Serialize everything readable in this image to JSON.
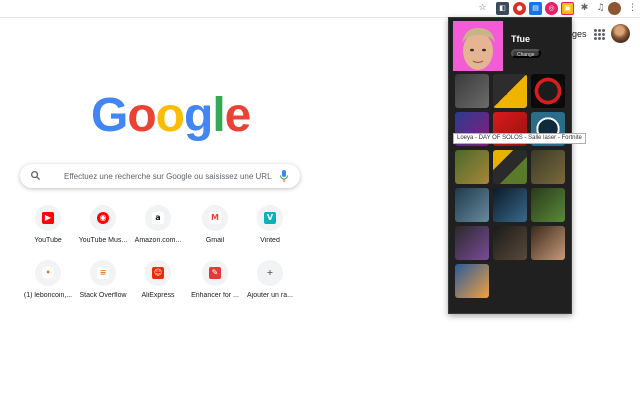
{
  "toolbar": {
    "icons": [
      "star-icon",
      "extension-a-icon",
      "extension-b-icon",
      "extension-c-icon",
      "extension-d-icon",
      "extension-e-icon",
      "extensions-puzzle-icon",
      "media-icon",
      "profile-avatar",
      "menu-dots-icon"
    ]
  },
  "header": {
    "images_link": "ages"
  },
  "logo": {
    "letters": [
      "G",
      "o",
      "o",
      "g",
      "l",
      "e"
    ],
    "colors": [
      "#4285F4",
      "#EA4335",
      "#FBBC05",
      "#4285F4",
      "#34A853",
      "#EA4335"
    ]
  },
  "search": {
    "placeholder": "Effectuez une recherche sur Google ou saisissez une URL"
  },
  "shortcuts": [
    {
      "label": "YouTube",
      "icon": "youtube-icon",
      "color": "#FF0000",
      "glyph": "▶"
    },
    {
      "label": "YouTube Mus...",
      "icon": "youtube-music-icon",
      "color": "#FF0000",
      "glyph": "◉"
    },
    {
      "label": "Amazon.com...",
      "icon": "amazon-icon",
      "color": "#ffffff",
      "glyph": "a"
    },
    {
      "label": "Gmail",
      "icon": "gmail-icon",
      "color": "#ffffff",
      "glyph": "M"
    },
    {
      "label": "Vinted",
      "icon": "vinted-icon",
      "color": "#09B1BA",
      "glyph": "V"
    },
    {
      "label": "(1) leboncoin,...",
      "icon": "leboncoin-icon",
      "color": "#ffffff",
      "glyph": "•"
    },
    {
      "label": "Stack Overflow",
      "icon": "stackoverflow-icon",
      "color": "#ffffff",
      "glyph": "≡"
    },
    {
      "label": "AliExpress",
      "icon": "aliexpress-icon",
      "color": "#E62E04",
      "glyph": "☺"
    },
    {
      "label": "Enhancer for ...",
      "icon": "enhancer-icon",
      "color": "#E53935",
      "glyph": "✎"
    },
    {
      "label": "Ajouter un ra...",
      "icon": "add-shortcut-icon",
      "color": "#f1f3f4",
      "glyph": "+"
    }
  ],
  "popup": {
    "streamer_name": "Tfue",
    "change_label": "Change",
    "tooltip": "Loeya - DAY OF SOLOS - Salle laser - Fortnite",
    "thumbnails": [
      {
        "bg": "linear-gradient(135deg,#3a3a3a,#6b6b6b)"
      },
      {
        "bg": "linear-gradient(135deg,#2d2d2d 50%,#f0b400 50%)"
      },
      {
        "bg": "radial-gradient(circle,#1c1c1c 40%,#d91c1c 41% 55%,#0a0a0a 56%)"
      },
      {
        "bg": "linear-gradient(135deg,#2a3b8f,#8a1c7c)"
      },
      {
        "bg": "linear-gradient(135deg,#d81b1b,#9b0f0f)"
      },
      {
        "bg": "radial-gradient(circle,#0f2a3a 40%,#ffffff 41% 48%,#2a6d8a 49%)"
      },
      {
        "bg": "linear-gradient(135deg,#4a6a2a,#a8863a)"
      },
      {
        "bg": "linear-gradient(135deg,#e8b000 0 30%,#2a2a2a 30% 60%,#5a7a2a 60%)"
      },
      {
        "bg": "linear-gradient(135deg,#3a3a2a,#7a6a3a)"
      },
      {
        "bg": "linear-gradient(135deg,#1f3a4a,#6a8aa0)"
      },
      {
        "bg": "linear-gradient(135deg,#0a1a2a,#3a6a8a)"
      },
      {
        "bg": "linear-gradient(135deg,#2a3a1a,#5a8a3a)"
      },
      {
        "bg": "linear-gradient(135deg,#2a2a2a,#7a4a9a)"
      },
      {
        "bg": "linear-gradient(135deg,#1a1a1a,#5a4a3a)"
      },
      {
        "bg": "linear-gradient(135deg,#3a2a1a,#c89a7a)"
      },
      {
        "bg": "linear-gradient(135deg,#2a5a9a,#f0a040)"
      }
    ]
  }
}
